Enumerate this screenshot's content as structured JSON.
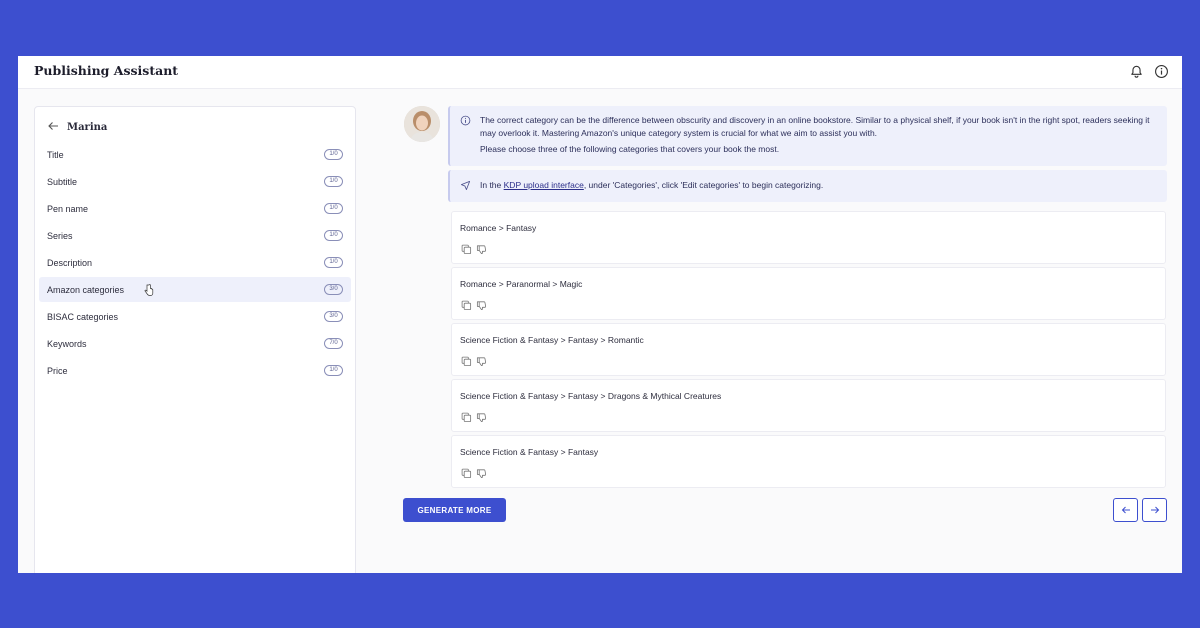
{
  "app": {
    "title": "Publishing Assistant"
  },
  "sidebar": {
    "back_label": "Marina",
    "items": [
      {
        "label": "Title",
        "badge": "1/0",
        "active": false
      },
      {
        "label": "Subtitle",
        "badge": "1/0",
        "active": false
      },
      {
        "label": "Pen name",
        "badge": "1/0",
        "active": false
      },
      {
        "label": "Series",
        "badge": "1/0",
        "active": false
      },
      {
        "label": "Description",
        "badge": "1/0",
        "active": false
      },
      {
        "label": "Amazon categories",
        "badge": "3/0",
        "active": true
      },
      {
        "label": "BISAC categories",
        "badge": "3/0",
        "active": false
      },
      {
        "label": "Keywords",
        "badge": "7/0",
        "active": false
      },
      {
        "label": "Price",
        "badge": "1/0",
        "active": false
      }
    ]
  },
  "messages": {
    "info_paragraph": "The correct category can be the difference between obscurity and discovery in an online bookstore. Similar to a physical shelf, if your book isn't in the right spot, readers seeking it may overlook it. Mastering Amazon's unique category system is crucial for what we aim to assist you with.",
    "info_instruction": "Please choose three of the following categories that covers your book the most.",
    "kdp_prefix": "In the ",
    "kdp_link": "KDP upload interface",
    "kdp_suffix": ", under 'Categories', click 'Edit categories' to begin categorizing."
  },
  "categories": [
    "Romance > Fantasy",
    "Romance > Paranormal > Magic",
    "Science Fiction & Fantasy > Fantasy > Romantic",
    "Science Fiction & Fantasy > Fantasy > Dragons & Mythical Creatures",
    "Science Fiction & Fantasy > Fantasy"
  ],
  "actions": {
    "generate_more": "GENERATE MORE"
  },
  "colors": {
    "accent": "#3d4fcf",
    "info_bg": "#eef0fb",
    "frame_bg": "#3d4fcf"
  },
  "icons": [
    "bell-icon",
    "info-icon",
    "back-arrow-icon",
    "copy-icon",
    "thumbs-down-icon",
    "send-icon",
    "arrow-left-icon",
    "arrow-right-icon"
  ]
}
